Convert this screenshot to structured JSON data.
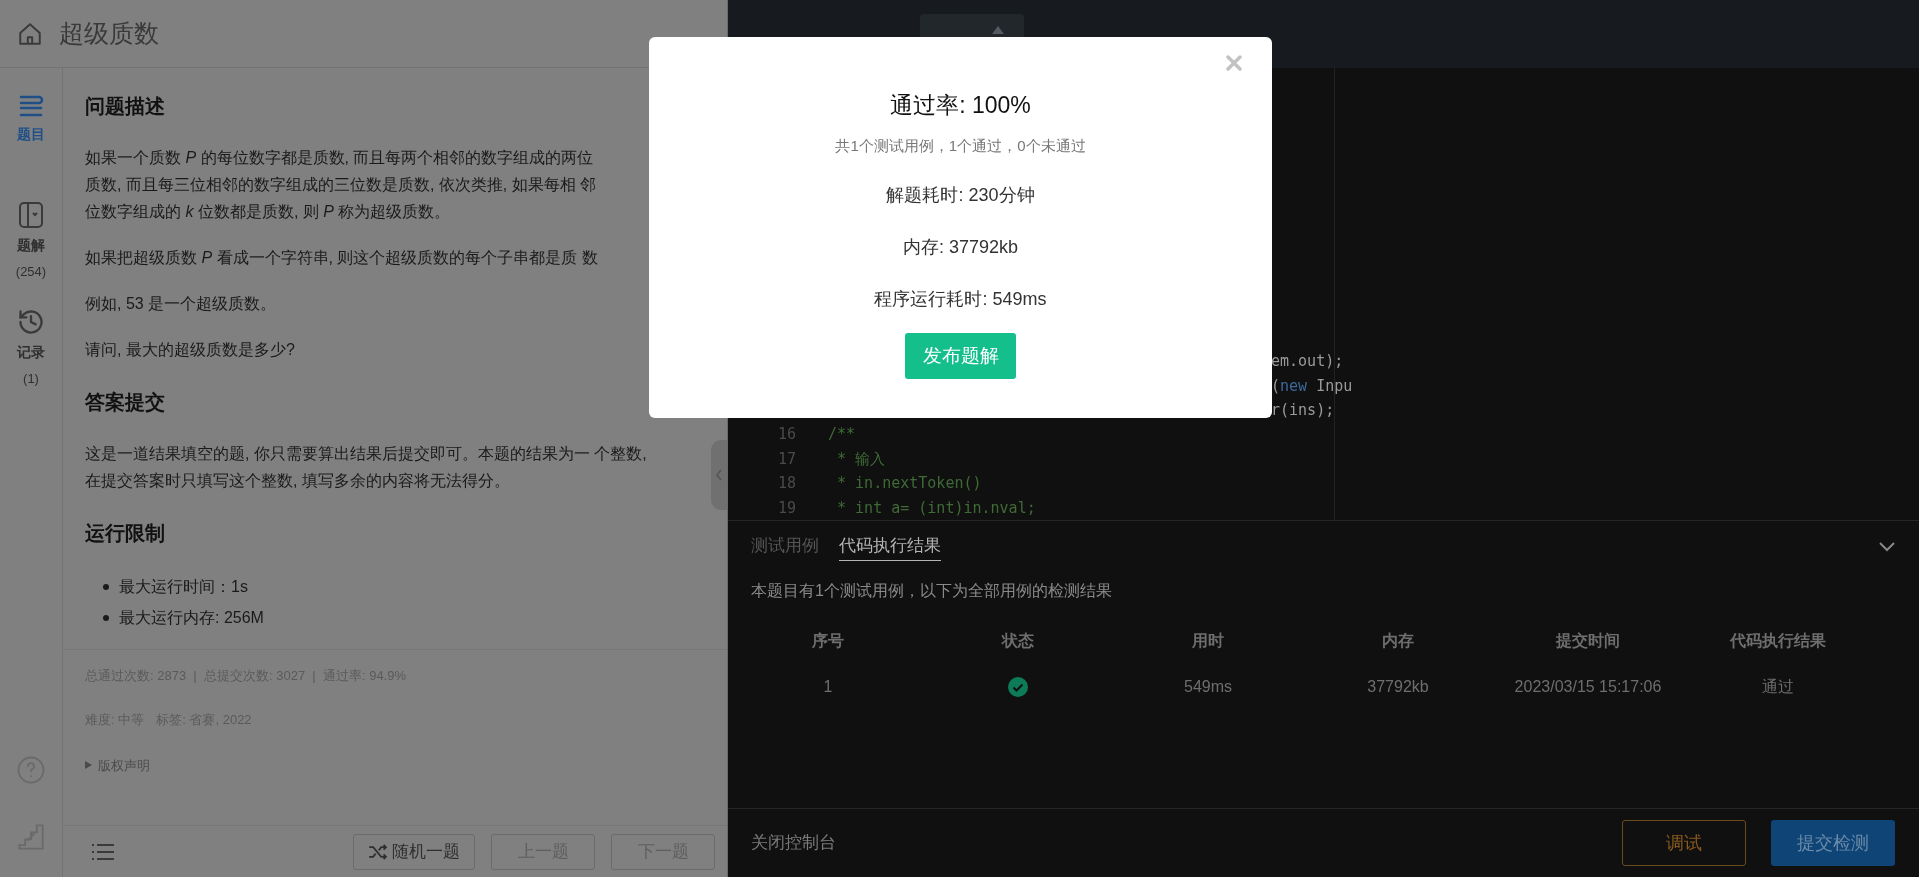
{
  "header": {
    "title": "超级质数"
  },
  "rail": {
    "items": [
      {
        "kind": "problem",
        "label": "题目",
        "selected": true
      },
      {
        "kind": "solution",
        "label": "题解",
        "count": "(254)",
        "selected": false
      },
      {
        "kind": "history",
        "label": "记录",
        "count": "(1)",
        "selected": false
      }
    ]
  },
  "problem": {
    "sections": [
      {
        "heading": "问题描述",
        "blocks": [
          {
            "kind": "para",
            "lines": [
              "如果一个质数 *P* 的每位数字都是质数, 而且每两个相邻的数字组成的两位",
              "质数, 而且每三位相邻的数字组成的三位数是质数, 依次类推, 如果每相 邻",
              "位数字组成的 *k* 位数都是质数, 则 *P* 称为超级质数。"
            ]
          },
          {
            "kind": "para",
            "lines": [
              "如果把超级质数 *P* 看成一个字符串, 则这个超级质数的每个子串都是质 数"
            ]
          },
          {
            "kind": "para",
            "lines": [
              "例如, 53 是一个超级质数。"
            ]
          },
          {
            "kind": "para",
            "lines": [
              "请问, 最大的超级质数是多少?"
            ]
          }
        ]
      },
      {
        "heading": "答案提交",
        "blocks": [
          {
            "kind": "para",
            "lines": [
              "这是一道结果填空的题, 你只需要算出结果后提交即可。本题的结果为一 个整数,",
              "在提交答案时只填写这个整数, 填写多余的内容将无法得分。"
            ]
          }
        ]
      },
      {
        "heading": "运行限制",
        "blocks": [
          {
            "kind": "bullets",
            "lines": [
              "最大运行时间：1s",
              "最大运行内存: 256M"
            ]
          }
        ]
      }
    ],
    "stats": "总通过次数: 2873  |  总提交次数: 3027  |  通过率: 94.9%",
    "meta": [
      "难度: 中等",
      "标签: 省赛, 2022"
    ],
    "copyright": {
      "label": "版权声明",
      "expanded": false
    }
  },
  "nav_buttons": [
    {
      "kind": "random",
      "label": "随机一题"
    },
    {
      "kind": "plain",
      "label": "上一题"
    },
    {
      "kind": "plain",
      "label": "下一题"
    }
  ],
  "editor": {
    "lines": [
      {
        "kind": "clipped",
        "segments": [
          {
            "kind": "plain",
            "text": "em.out);"
          }
        ]
      },
      {
        "kind": "clipped",
        "segments": [
          {
            "kind": "plain",
            "text": "("
          },
          {
            "kind": "keyword",
            "text": "new"
          },
          {
            "kind": "plain",
            "text": " Inpu"
          }
        ]
      },
      {
        "kind": "clipped",
        "segments": [
          {
            "kind": "plain",
            "text": "r(ins);"
          }
        ]
      },
      {
        "kind": "full",
        "number": "16",
        "segments": [
          {
            "kind": "comment",
            "text": "/**"
          }
        ]
      },
      {
        "kind": "full",
        "number": "17",
        "segments": [
          {
            "kind": "comment",
            "text": " * 输入"
          }
        ]
      },
      {
        "kind": "full",
        "number": "18",
        "segments": [
          {
            "kind": "comment",
            "text": " * in.nextToken()"
          }
        ]
      },
      {
        "kind": "full",
        "number": "19",
        "segments": [
          {
            "kind": "comment",
            "text": " * int a= (int)in.nval;"
          }
        ]
      }
    ]
  },
  "console": {
    "tabs": [
      {
        "label": "测试用例",
        "selected": false
      },
      {
        "label": "代码执行结果",
        "selected": true
      }
    ],
    "summary": "本题目有1个测试用例，以下为全部用例的检测结果",
    "columns": [
      "序号",
      "状态",
      "用时",
      "内存",
      "提交时间",
      "代码执行结果"
    ],
    "rows": [
      {
        "index": "1",
        "passed": true,
        "time": "549ms",
        "memory": "37792kb",
        "submitted": "2023/03/15 15:17:06",
        "result": "通过"
      }
    ]
  },
  "footer": {
    "close_console": "关闭控制台",
    "buttons": [
      {
        "kind": "outline",
        "label": "调试"
      },
      {
        "kind": "primary",
        "label": "提交检测"
      }
    ]
  },
  "dialog": {
    "title": "通过率: 100%",
    "subtitle": "共1个测试用例，1个通过，0个未通过",
    "lines": [
      "解题耗时: 230分钟",
      "内存: 37792kb",
      "程序运行耗时: 549ms"
    ],
    "button": "发布题解"
  }
}
